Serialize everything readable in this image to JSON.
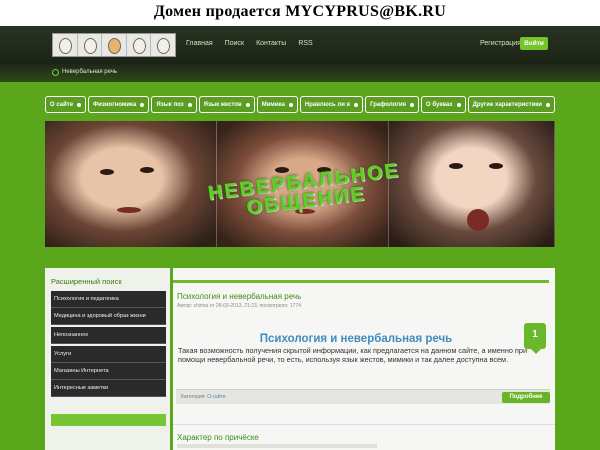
{
  "banner": {
    "text": "Домен продается   MYCYPRUS@BK.RU"
  },
  "header": {
    "nav": [
      "Главная",
      "Поиск",
      "Контакты",
      "RSS"
    ],
    "register": "Регистрация",
    "login": "Войти"
  },
  "breadcrumb": {
    "current": "Невербальная речь"
  },
  "categories": [
    "О сайте",
    "Физиогномика",
    "Язык поз",
    "Язык жестов",
    "Мимика",
    "Нравлюсь ли я",
    "Графология",
    "О буквах",
    "Другие характеристики"
  ],
  "hero": {
    "title_line1": "НЕВЕРБАЛЬНОЕ",
    "title_line2": "ОБЩЕНИЕ"
  },
  "sidebar": {
    "search_title": "Расширенный поиск",
    "menu": [
      "Психология и педагогика",
      "Медицина и здоровый образ жизни",
      "Непознанное",
      "Услуги",
      "Магазины Интернета",
      "Интересные заметки"
    ]
  },
  "post": {
    "title": "Психология и невербальная речь",
    "meta": "Автор: chirina от 28-03-2013, 21:23, посмотрело: 1774",
    "heading": "Психология и невербальная речь",
    "body": "Такая возможность получения скрытой информации, как предлагается на данном сайте, а именно при помощи невербальной речи, то есть, используя язык жестов, мимики и так далее доступна всем.",
    "comments": "1",
    "category_label": "Категория:",
    "category_value": "О сайте",
    "more": "Подробнее"
  },
  "post2": {
    "title": "Характер по причёске"
  }
}
